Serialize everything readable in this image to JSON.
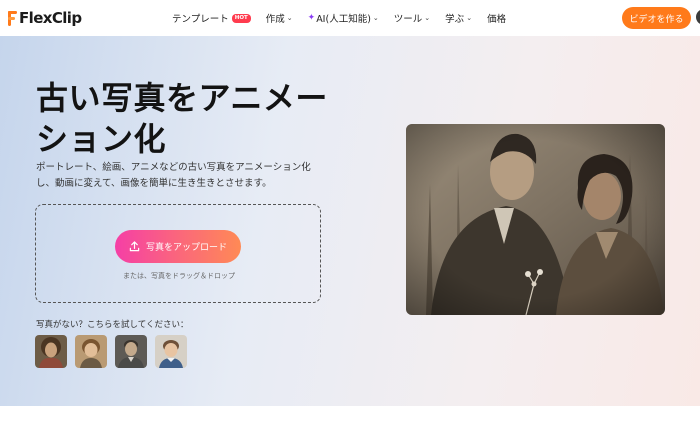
{
  "brand": {
    "name": "FlexClip",
    "colors": {
      "accent_orange": "#ff7a1a",
      "hot_red": "#ff3b4e",
      "gradient_pink": "#f53fa6",
      "gradient_orange": "#ff8a55",
      "ai_purple": "#8a3df5"
    }
  },
  "nav": {
    "items": [
      {
        "label": "テンプレート",
        "badge": "HOT",
        "dropdown": false
      },
      {
        "label": "作成",
        "dropdown": true
      },
      {
        "label": "AI(人工知能)",
        "icon": "sparkle-icon",
        "dropdown": true
      },
      {
        "label": "ツール",
        "dropdown": true
      },
      {
        "label": "学ぶ",
        "dropdown": true
      },
      {
        "label": "価格",
        "dropdown": false
      }
    ],
    "cta_label": "ビデオを作る"
  },
  "hero": {
    "title": "古い写真をアニメーション化",
    "description": "ポートレート、絵画、アニメなどの古い写真をアニメーション化し、動画に変えて、画像を簡単に生き生きとさせます。",
    "upload_button_label": "写真をアップロード",
    "upload_icon": "upload-icon",
    "drop_hint": "または、写真をドラッグ＆ドロップ",
    "sample_label": "写真がない？こちらを試してください：",
    "sample_thumbnails": [
      "sample-portrait-woman",
      "sample-portrait-child",
      "sample-portrait-man",
      "sample-portrait-boy"
    ],
    "preview_image": "vintage-couple-photo"
  }
}
